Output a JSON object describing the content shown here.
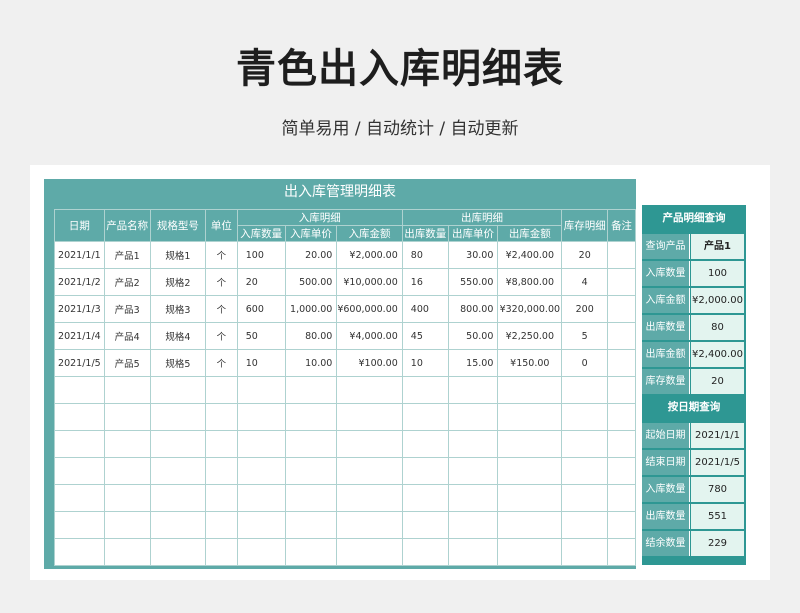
{
  "page": {
    "title": "青色出入库明细表",
    "subtitle": "简单易用  /  自动统计  /  自动更新"
  },
  "sheet": {
    "title": "出入库管理明细表",
    "headers": {
      "date": "日期",
      "product": "产品名称",
      "spec": "规格型号",
      "unit": "单位",
      "in_group": "入库明细",
      "out_group": "出库明细",
      "stock": "库存明细",
      "note": "备注",
      "in_qty": "入库数量",
      "in_price": "入库单价",
      "in_amount": "入库金额",
      "out_qty": "出库数量",
      "out_price": "出库单价",
      "out_amount": "出库金额"
    },
    "rows": [
      {
        "date": "2021/1/1",
        "product": "产品1",
        "spec": "规格1",
        "unit": "个",
        "in_qty": "100",
        "in_price": "20.00",
        "in_amount": "¥2,000.00",
        "out_qty": "80",
        "out_price": "30.00",
        "out_amount": "¥2,400.00",
        "stock": "20",
        "note": ""
      },
      {
        "date": "2021/1/2",
        "product": "产品2",
        "spec": "规格2",
        "unit": "个",
        "in_qty": "20",
        "in_price": "500.00",
        "in_amount": "¥10,000.00",
        "out_qty": "16",
        "out_price": "550.00",
        "out_amount": "¥8,800.00",
        "stock": "4",
        "note": ""
      },
      {
        "date": "2021/1/3",
        "product": "产品3",
        "spec": "规格3",
        "unit": "个",
        "in_qty": "600",
        "in_price": "1,000.00",
        "in_amount": "¥600,000.00",
        "out_qty": "400",
        "out_price": "800.00",
        "out_amount": "¥320,000.00",
        "stock": "200",
        "note": ""
      },
      {
        "date": "2021/1/4",
        "product": "产品4",
        "spec": "规格4",
        "unit": "个",
        "in_qty": "50",
        "in_price": "80.00",
        "in_amount": "¥4,000.00",
        "out_qty": "45",
        "out_price": "50.00",
        "out_amount": "¥2,250.00",
        "stock": "5",
        "note": ""
      },
      {
        "date": "2021/1/5",
        "product": "产品5",
        "spec": "规格5",
        "unit": "个",
        "in_qty": "10",
        "in_price": "10.00",
        "in_amount": "¥100.00",
        "out_qty": "10",
        "out_price": "15.00",
        "out_amount": "¥150.00",
        "stock": "0",
        "note": ""
      },
      {
        "date": "",
        "product": "",
        "spec": "",
        "unit": "",
        "in_qty": "",
        "in_price": "",
        "in_amount": "",
        "out_qty": "",
        "out_price": "",
        "out_amount": "",
        "stock": "",
        "note": ""
      },
      {
        "date": "",
        "product": "",
        "spec": "",
        "unit": "",
        "in_qty": "",
        "in_price": "",
        "in_amount": "",
        "out_qty": "",
        "out_price": "",
        "out_amount": "",
        "stock": "",
        "note": ""
      },
      {
        "date": "",
        "product": "",
        "spec": "",
        "unit": "",
        "in_qty": "",
        "in_price": "",
        "in_amount": "",
        "out_qty": "",
        "out_price": "",
        "out_amount": "",
        "stock": "",
        "note": ""
      },
      {
        "date": "",
        "product": "",
        "spec": "",
        "unit": "",
        "in_qty": "",
        "in_price": "",
        "in_amount": "",
        "out_qty": "",
        "out_price": "",
        "out_amount": "",
        "stock": "",
        "note": ""
      },
      {
        "date": "",
        "product": "",
        "spec": "",
        "unit": "",
        "in_qty": "",
        "in_price": "",
        "in_amount": "",
        "out_qty": "",
        "out_price": "",
        "out_amount": "",
        "stock": "",
        "note": ""
      },
      {
        "date": "",
        "product": "",
        "spec": "",
        "unit": "",
        "in_qty": "",
        "in_price": "",
        "in_amount": "",
        "out_qty": "",
        "out_price": "",
        "out_amount": "",
        "stock": "",
        "note": ""
      },
      {
        "date": "",
        "product": "",
        "spec": "",
        "unit": "",
        "in_qty": "",
        "in_price": "",
        "in_amount": "",
        "out_qty": "",
        "out_price": "",
        "out_amount": "",
        "stock": "",
        "note": ""
      }
    ]
  },
  "product_query": {
    "title": "产品明细查询",
    "rows": [
      {
        "label": "查询产品",
        "value": "产品1"
      },
      {
        "label": "入库数量",
        "value": "100"
      },
      {
        "label": "入库金额",
        "value": "¥2,000.00"
      },
      {
        "label": "出库数量",
        "value": "80"
      },
      {
        "label": "出库金额",
        "value": "¥2,400.00"
      },
      {
        "label": "库存数量",
        "value": "20"
      }
    ]
  },
  "date_query": {
    "title": "按日期查询",
    "rows": [
      {
        "label": "起始日期",
        "value": "2021/1/1"
      },
      {
        "label": "结束日期",
        "value": "2021/1/5"
      },
      {
        "label": "入库数量",
        "value": "780"
      },
      {
        "label": "出库数量",
        "value": "551"
      },
      {
        "label": "结余数量",
        "value": "229"
      }
    ]
  },
  "colors": {
    "header_teal": "#5eaaa8",
    "panel_teal": "#2e9793",
    "value_mint": "#e3f4ef",
    "grid_line": "#aed2d0"
  }
}
